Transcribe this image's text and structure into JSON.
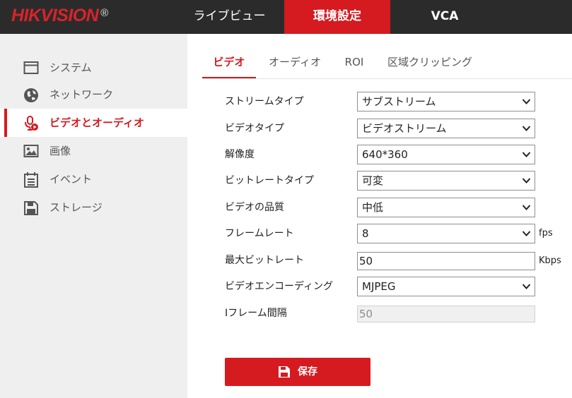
{
  "brand": {
    "name": "HIKVISION",
    "mark": "®",
    "color": "#d8232a"
  },
  "topnav": {
    "items": [
      {
        "label": "ライブビュー",
        "active": false
      },
      {
        "label": "環境設定",
        "active": true
      },
      {
        "label": "VCA",
        "active": false
      }
    ]
  },
  "sidebar": {
    "items": [
      {
        "label": "システム",
        "icon": "system-window-icon",
        "active": false
      },
      {
        "label": "ネットワーク",
        "icon": "globe-icon",
        "active": false
      },
      {
        "label": "ビデオとオーディオ",
        "icon": "microphone-video-icon",
        "active": true
      },
      {
        "label": "画像",
        "icon": "image-icon",
        "active": false
      },
      {
        "label": "イベント",
        "icon": "calendar-icon",
        "active": false
      },
      {
        "label": "ストレージ",
        "icon": "floppy-disk-icon",
        "active": false
      }
    ]
  },
  "subtabs": [
    {
      "label": "ビデオ",
      "active": true
    },
    {
      "label": "オーディオ",
      "active": false
    },
    {
      "label": "ROI",
      "active": false
    },
    {
      "label": "区域クリッピング",
      "active": false
    }
  ],
  "form": {
    "stream_type": {
      "label": "ストリームタイプ",
      "value": "サブストリーム"
    },
    "video_type": {
      "label": "ビデオタイプ",
      "value": "ビデオストリーム"
    },
    "resolution": {
      "label": "解像度",
      "value": "640*360"
    },
    "bitrate_type": {
      "label": "ビットレートタイプ",
      "value": "可変"
    },
    "video_quality": {
      "label": "ビデオの品質",
      "value": "中低"
    },
    "frame_rate": {
      "label": "フレームレート",
      "value": "8",
      "unit": "fps"
    },
    "max_bitrate": {
      "label": "最大ビットレート",
      "value": "50",
      "unit": "Kbps"
    },
    "video_encoding": {
      "label": "ビデオエンコーディング",
      "value": "MJPEG"
    },
    "i_frame_interval": {
      "label": "Iフレーム間隔",
      "value": "50"
    }
  },
  "actions": {
    "save_label": "保存"
  },
  "colors": {
    "accent": "#d51a20",
    "topbar": "#2b2b2b",
    "sidebar_bg": "#efefef"
  }
}
